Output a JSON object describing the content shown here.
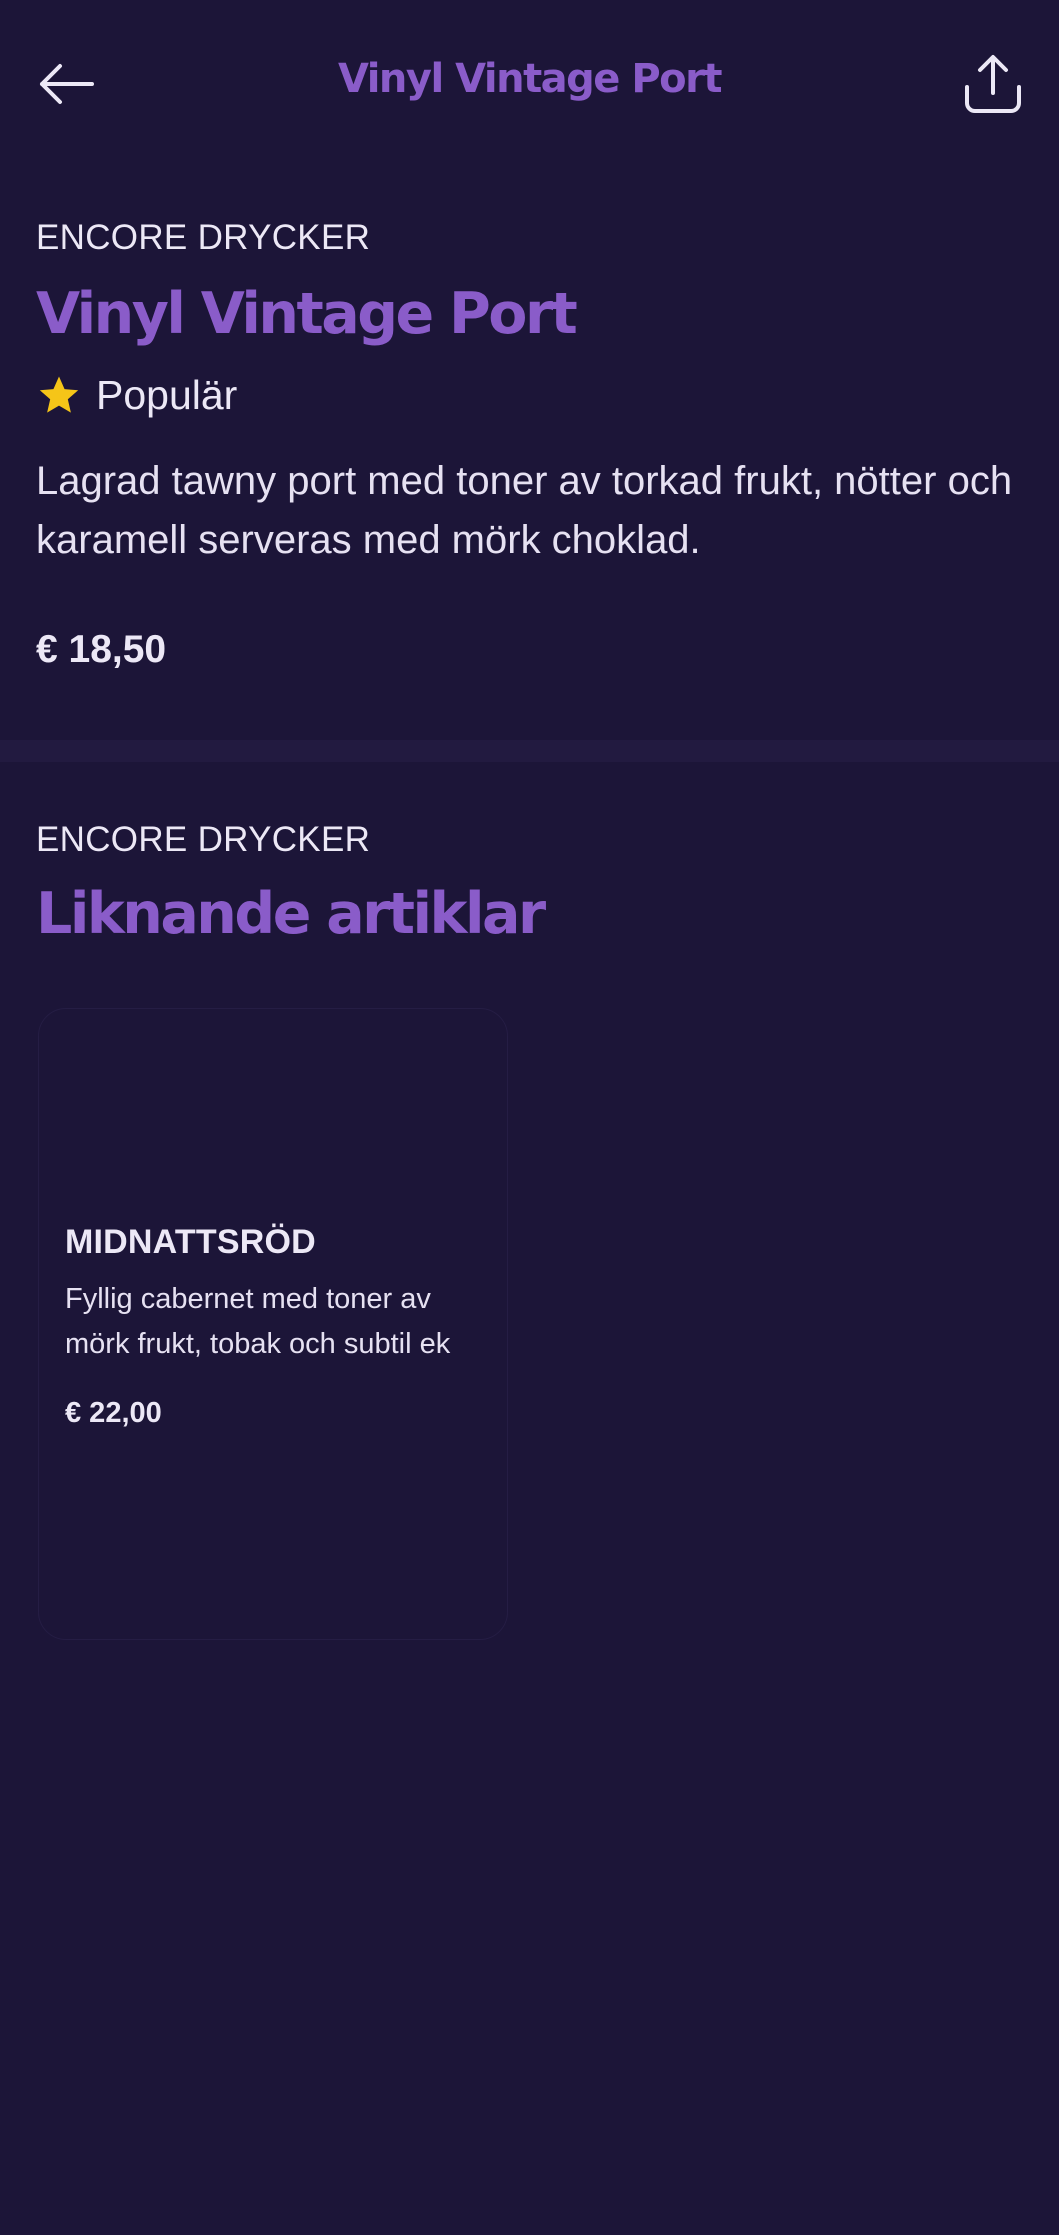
{
  "header": {
    "title": "Vinyl Vintage Port",
    "back_icon": "arrow-left-icon",
    "share_icon": "share-icon"
  },
  "product": {
    "category": "ENCORE DRYCKER",
    "name": "Vinyl Vintage Port",
    "badge": "Populär",
    "badge_icon": "star-icon",
    "description": "Lagrad tawny port med toner av torkad frukt, nötter och karamell serveras med mörk choklad.",
    "price": "€ 18,50"
  },
  "related": {
    "category": "ENCORE DRYCKER",
    "title": "Liknande artiklar",
    "items": [
      {
        "name": "MIDNATTSRÖD",
        "description": "Fyllig cabernet med toner av mörk frukt, tobak och subtil ek",
        "price": "€ 22,00"
      }
    ]
  },
  "colors": {
    "background": "#1c1538",
    "accent": "#8a5cc9",
    "star": "#f5c518",
    "text": "#ece8f6"
  }
}
